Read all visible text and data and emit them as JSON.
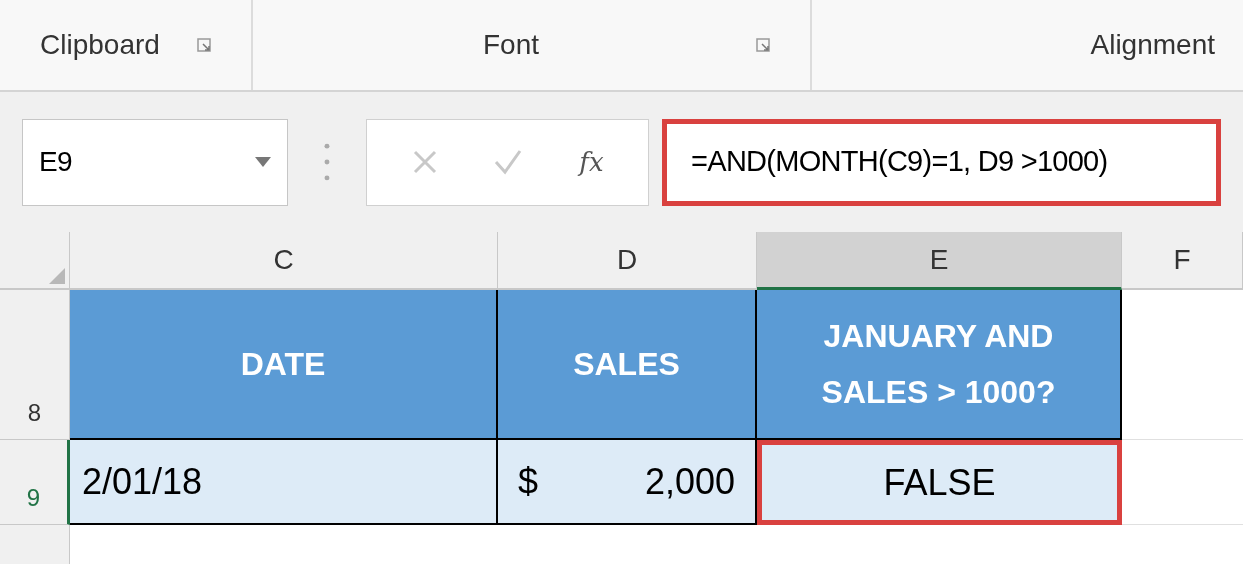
{
  "ribbon_groups": [
    {
      "label": "Clipboard",
      "has_launcher": true
    },
    {
      "label": "Font",
      "has_launcher": true
    },
    {
      "label": "Alignment",
      "has_launcher": false
    }
  ],
  "name_box": {
    "value": "E9"
  },
  "formula_buttons": {
    "cancel_disabled": true,
    "enter_disabled": true,
    "function_label": "fx"
  },
  "formula_bar": {
    "value": "=AND(MONTH(C9)=1, D9 >1000)",
    "highlighted": true
  },
  "columns": [
    {
      "label": "C",
      "selected": false
    },
    {
      "label": "D",
      "selected": false
    },
    {
      "label": "E",
      "selected": true
    },
    {
      "label": "F",
      "selected": false
    }
  ],
  "rows": [
    {
      "number": "8",
      "cells": [
        {
          "kind": "header",
          "text": "DATE"
        },
        {
          "kind": "header",
          "text": "SALES"
        },
        {
          "kind": "header",
          "lines": [
            "JANUARY AND",
            "SALES > 1000?"
          ]
        }
      ]
    },
    {
      "number": "9",
      "cells": [
        {
          "kind": "text",
          "text": "2/01/18"
        },
        {
          "kind": "currency",
          "symbol": "$",
          "text": "2,000"
        },
        {
          "kind": "center",
          "text": "FALSE",
          "highlighted": true
        }
      ]
    }
  ]
}
